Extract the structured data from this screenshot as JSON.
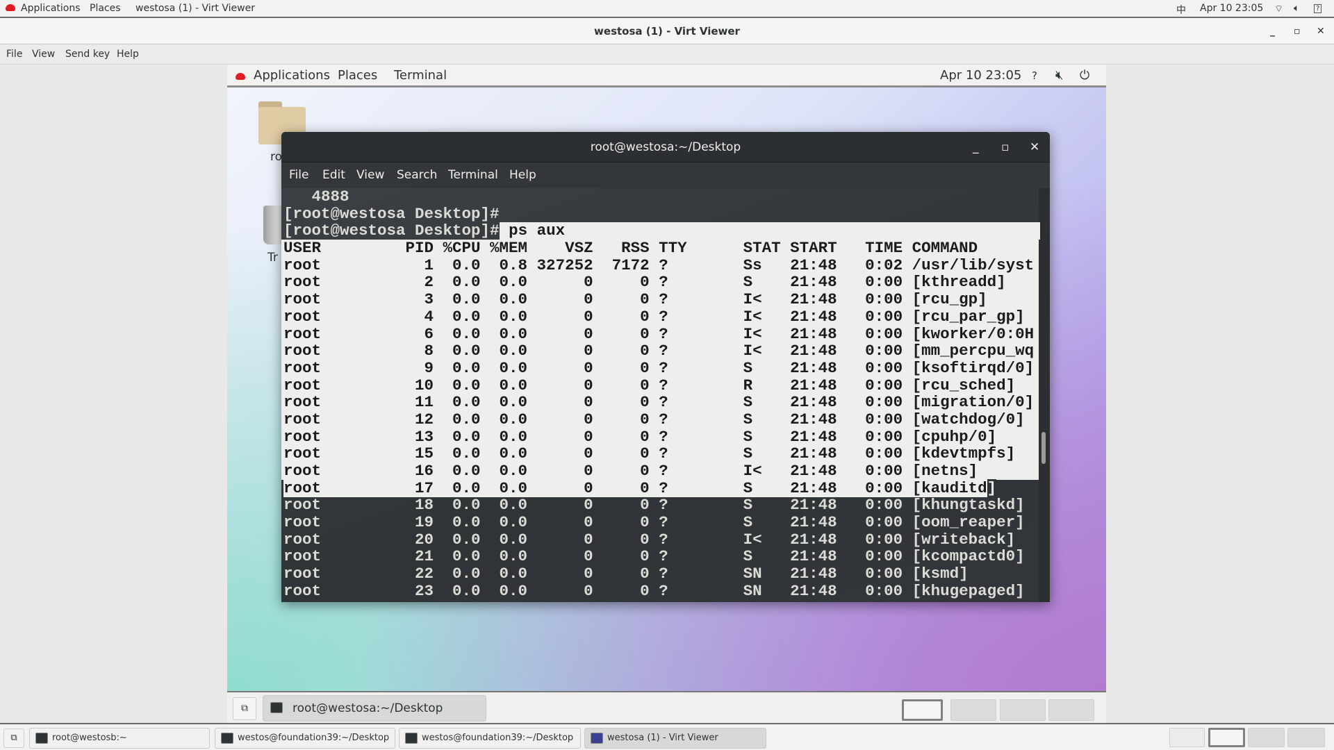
{
  "host_topbar": {
    "applications": "Applications",
    "places": "Places",
    "window_title": "westosa (1) - Virt Viewer",
    "input_method": "中",
    "clock": "Apr 10  23:05"
  },
  "virt_viewer": {
    "title": "westosa (1) - Virt Viewer",
    "menu": [
      "File",
      "View",
      "Send key",
      "Help"
    ]
  },
  "guest_topbar": {
    "applications": "Applications",
    "places": "Places",
    "terminal": "Terminal",
    "clock": "Apr 10  23:05"
  },
  "desktop_icons": [
    {
      "label": "ro"
    },
    {
      "label": "Tr"
    }
  ],
  "terminal": {
    "title": "root@westosa:~/Desktop",
    "menu": [
      "File",
      "Edit",
      "View",
      "Search",
      "Terminal",
      "Help"
    ],
    "pre_lines": [
      "   4888",
      "[root@westosa Desktop]#"
    ],
    "prompt": "[root@westosa Desktop]#",
    "command": " ps aux",
    "header": {
      "user": "USER",
      "pid": "PID",
      "cpu": "%CPU",
      "mem": "%MEM",
      "vsz": "VSZ",
      "rss": "RSS",
      "tty": "TTY",
      "stat": "STAT",
      "start": "START",
      "time": "TIME",
      "command": "COMMAND"
    },
    "rows": [
      [
        "root",
        "1",
        "0.0",
        "0.8",
        "327252",
        "7172",
        "?",
        "Ss",
        "21:48",
        "0:02",
        "/usr/lib/syst"
      ],
      [
        "root",
        "2",
        "0.0",
        "0.0",
        "0",
        "0",
        "?",
        "S",
        "21:48",
        "0:00",
        "[kthreadd]"
      ],
      [
        "root",
        "3",
        "0.0",
        "0.0",
        "0",
        "0",
        "?",
        "I<",
        "21:48",
        "0:00",
        "[rcu_gp]"
      ],
      [
        "root",
        "4",
        "0.0",
        "0.0",
        "0",
        "0",
        "?",
        "I<",
        "21:48",
        "0:00",
        "[rcu_par_gp]"
      ],
      [
        "root",
        "6",
        "0.0",
        "0.0",
        "0",
        "0",
        "?",
        "I<",
        "21:48",
        "0:00",
        "[kworker/0:0H"
      ],
      [
        "root",
        "8",
        "0.0",
        "0.0",
        "0",
        "0",
        "?",
        "I<",
        "21:48",
        "0:00",
        "[mm_percpu_wq"
      ],
      [
        "root",
        "9",
        "0.0",
        "0.0",
        "0",
        "0",
        "?",
        "S",
        "21:48",
        "0:00",
        "[ksoftirqd/0]"
      ],
      [
        "root",
        "10",
        "0.0",
        "0.0",
        "0",
        "0",
        "?",
        "R",
        "21:48",
        "0:00",
        "[rcu_sched]"
      ],
      [
        "root",
        "11",
        "0.0",
        "0.0",
        "0",
        "0",
        "?",
        "S",
        "21:48",
        "0:00",
        "[migration/0]"
      ],
      [
        "root",
        "12",
        "0.0",
        "0.0",
        "0",
        "0",
        "?",
        "S",
        "21:48",
        "0:00",
        "[watchdog/0]"
      ],
      [
        "root",
        "13",
        "0.0",
        "0.0",
        "0",
        "0",
        "?",
        "S",
        "21:48",
        "0:00",
        "[cpuhp/0]"
      ],
      [
        "root",
        "15",
        "0.0",
        "0.0",
        "0",
        "0",
        "?",
        "S",
        "21:48",
        "0:00",
        "[kdevtmpfs]"
      ],
      [
        "root",
        "16",
        "0.0",
        "0.0",
        "0",
        "0",
        "?",
        "I<",
        "21:48",
        "0:00",
        "[netns]"
      ],
      [
        "root",
        "17",
        "0.0",
        "0.0",
        "0",
        "0",
        "?",
        "S",
        "21:48",
        "0:00",
        "[kauditd]"
      ],
      [
        "root",
        "18",
        "0.0",
        "0.0",
        "0",
        "0",
        "?",
        "S",
        "21:48",
        "0:00",
        "[khungtaskd]"
      ],
      [
        "root",
        "19",
        "0.0",
        "0.0",
        "0",
        "0",
        "?",
        "S",
        "21:48",
        "0:00",
        "[oom_reaper]"
      ],
      [
        "root",
        "20",
        "0.0",
        "0.0",
        "0",
        "0",
        "?",
        "I<",
        "21:48",
        "0:00",
        "[writeback]"
      ],
      [
        "root",
        "21",
        "0.0",
        "0.0",
        "0",
        "0",
        "?",
        "S",
        "21:48",
        "0:00",
        "[kcompactd0]"
      ],
      [
        "root",
        "22",
        "0.0",
        "0.0",
        "0",
        "0",
        "?",
        "SN",
        "21:48",
        "0:00",
        "[ksmd]"
      ],
      [
        "root",
        "23",
        "0.0",
        "0.0",
        "0",
        "0",
        "?",
        "SN",
        "21:48",
        "0:00",
        "[khugepaged]"
      ]
    ]
  },
  "guest_panel": {
    "task": "root@westosa:~/Desktop"
  },
  "host_taskbar": {
    "tasks": [
      "root@westosb:~",
      "westos@foundation39:~/Desktop",
      "westos@foundation39:~/Desktop",
      "westosa (1) - Virt Viewer"
    ]
  },
  "colors": {
    "accent_red": "#e01b24",
    "terminal_bg": "#2e3436",
    "selection_bg": "#eeeeec"
  }
}
